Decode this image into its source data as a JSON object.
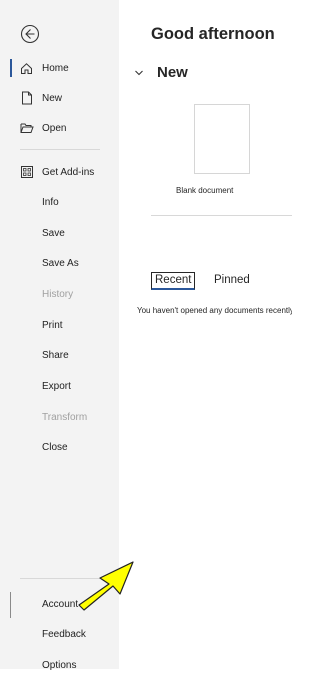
{
  "sidebar": {
    "back_icon": "back-arrow-circle-icon",
    "items": [
      {
        "label": "Home",
        "icon": "home-icon"
      },
      {
        "label": "New",
        "icon": "new-document-icon"
      },
      {
        "label": "Open",
        "icon": "folder-open-icon"
      },
      {
        "label": "Get Add-ins",
        "icon": "add-ins-grid-icon"
      },
      {
        "label": "Info"
      },
      {
        "label": "Save"
      },
      {
        "label": "Save As"
      },
      {
        "label": "History",
        "disabled": true
      },
      {
        "label": "Print"
      },
      {
        "label": "Share"
      },
      {
        "label": "Export"
      },
      {
        "label": "Transform",
        "disabled": true
      },
      {
        "label": "Close"
      },
      {
        "label": "Account"
      },
      {
        "label": "Feedback"
      },
      {
        "label": "Options"
      }
    ]
  },
  "main": {
    "greeting": "Good afternoon",
    "new_section": {
      "title": "New",
      "templates": [
        {
          "label": "Blank document"
        }
      ]
    },
    "tabs": [
      {
        "label": "Recent",
        "selected": true
      },
      {
        "label": "Pinned",
        "selected": false
      }
    ],
    "empty_message": "You haven't opened any documents recently."
  },
  "colors": {
    "accent": "#2b579a",
    "sidebar_bg": "#f3f3f3",
    "annotation_arrow_fill": "#ffff00"
  }
}
